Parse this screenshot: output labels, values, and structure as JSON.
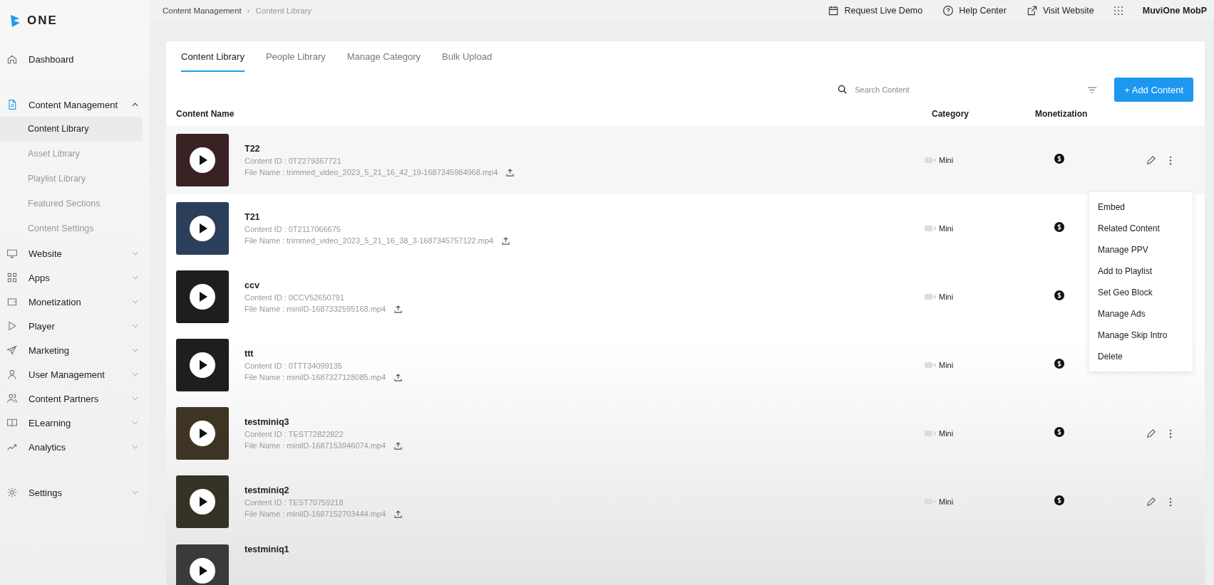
{
  "logo": {
    "text": "ONE"
  },
  "sidebar": {
    "items": [
      {
        "label": "Dashboard"
      },
      {
        "label": "Content Management",
        "expanded": true,
        "children": [
          {
            "label": "Content Library",
            "selected": true
          },
          {
            "label": "Asset Library",
            "selected": false
          },
          {
            "label": "Playlist Library",
            "selected": false
          },
          {
            "label": "Featured Sections",
            "selected": false
          },
          {
            "label": "Content Settings",
            "selected": false
          }
        ]
      },
      {
        "label": "Website",
        "expanded": false
      },
      {
        "label": "Apps",
        "expanded": false
      },
      {
        "label": "Monetization",
        "expanded": false
      },
      {
        "label": "Player",
        "expanded": false
      },
      {
        "label": "Marketing",
        "expanded": false
      },
      {
        "label": "User Management",
        "expanded": false
      },
      {
        "label": "Content Partners",
        "expanded": false
      },
      {
        "label": "ELearning",
        "expanded": false
      },
      {
        "label": "Analytics",
        "expanded": false
      },
      {
        "label": "Settings",
        "expanded": false
      }
    ]
  },
  "breadcrumb": {
    "items": [
      "Content Management",
      "Content Library"
    ],
    "separator": "›"
  },
  "top_links": [
    {
      "label": "Request Live Demo"
    },
    {
      "label": "Help Center"
    },
    {
      "label": "Visit Website"
    }
  ],
  "account": {
    "name": "MuviOne MobP"
  },
  "tabs": [
    {
      "label": "Content Library",
      "selected": true
    },
    {
      "label": "People Library",
      "selected": false
    },
    {
      "label": "Manage Category",
      "selected": false
    },
    {
      "label": "Bulk Upload",
      "selected": false
    }
  ],
  "search": {
    "placeholder": "Search Content"
  },
  "add_button": {
    "label": "+ Add Content"
  },
  "table": {
    "columns": [
      "Content Name",
      "Category",
      "Monetization"
    ],
    "rows": [
      {
        "name": "T22",
        "content_id": "Content ID : 0T2279367721",
        "file_name": "File Name : trimmed_video_2023_5_21_16_42_19-1687345984968.mp4",
        "category": "Mini",
        "monetized": true,
        "hovered": true
      },
      {
        "name": "T21",
        "content_id": "Content ID : 0T2117066675",
        "file_name": "File Name : trimmed_video_2023_5_21_16_38_3-1687345757122.mp4",
        "category": "Mini",
        "monetized": true,
        "hovered": false
      },
      {
        "name": "ccv",
        "content_id": "Content ID : 0CCV52650791",
        "file_name": "File Name : miniID-1687332595168.mp4",
        "category": "Mini",
        "monetized": true,
        "hovered": false
      },
      {
        "name": "ttt",
        "content_id": "Content ID : 0TTT34099135",
        "file_name": "File Name : miniID-1687327128085.mp4",
        "category": "Mini",
        "monetized": true,
        "hovered": false
      },
      {
        "name": "testminiq3",
        "content_id": "Content ID : TEST72822822",
        "file_name": "File Name : miniID-1687153946074.mp4",
        "category": "Mini",
        "monetized": true,
        "hovered": false
      },
      {
        "name": "testminiq2",
        "content_id": "Content ID : TEST70759218",
        "file_name": "File Name : miniID-1687152703444.mp4",
        "category": "Mini",
        "monetized": true,
        "hovered": false
      },
      {
        "name": "testminiq1",
        "hovered": false
      }
    ]
  },
  "context_menu": {
    "items": [
      "Embed",
      "Related Content",
      "Manage PPV",
      "Add to Playlist",
      "Set Geo Block",
      "Manage Ads",
      "Manage Skip Intro",
      "Delete"
    ]
  }
}
